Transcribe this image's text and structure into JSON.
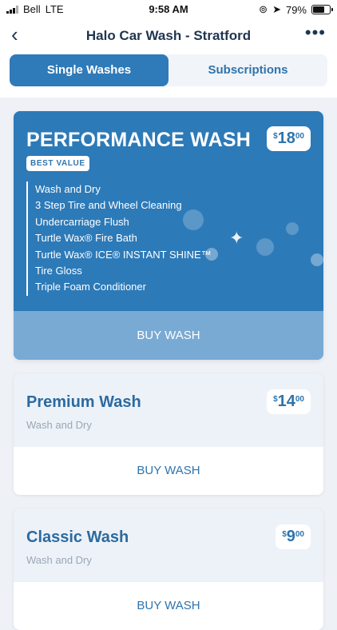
{
  "status_bar": {
    "carrier": "Bell",
    "network": "LTE",
    "time": "9:58 AM",
    "battery": "79%",
    "battery_level": 0.79
  },
  "header": {
    "back_icon": "chevron-left-icon",
    "title": "Halo Car Wash - Stratford",
    "more_icon": "more-horizontal-icon"
  },
  "tabs": [
    {
      "label": "Single Washes",
      "active": true
    },
    {
      "label": "Subscriptions",
      "active": false
    }
  ],
  "featured": {
    "title": "PERFORMANCE WASH",
    "price_currency": "$",
    "price_dollars": "18",
    "price_cents": "00",
    "badge": "BEST VALUE",
    "features": [
      "Wash and Dry",
      "3 Step Tire and Wheel Cleaning",
      "Undercarriage Flush",
      "Turtle Wax® Fire Bath",
      "Turtle Wax® ICE® INSTANT SHINE™",
      "Tire Gloss",
      "Triple Foam Conditioner"
    ],
    "button": "BUY WASH",
    "color": "#2d7ab8"
  },
  "washes": [
    {
      "title": "Premium Wash",
      "subtitle": "Wash and Dry",
      "price_currency": "$",
      "price_dollars": "14",
      "price_cents": "00",
      "button": "BUY WASH"
    },
    {
      "title": "Classic Wash",
      "subtitle": "Wash and Dry",
      "price_currency": "$",
      "price_dollars": "9",
      "price_cents": "00",
      "button": "BUY WASH"
    }
  ]
}
